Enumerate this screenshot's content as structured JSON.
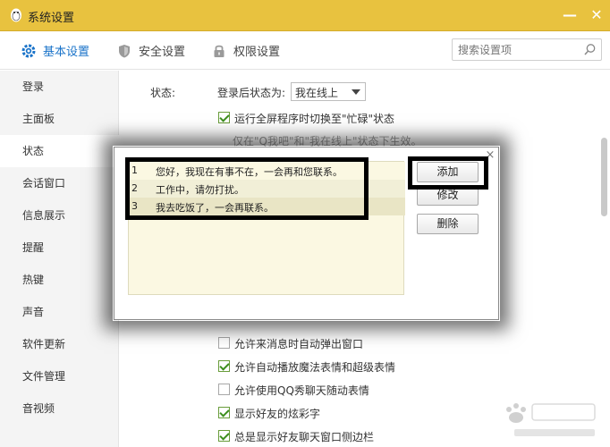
{
  "window": {
    "title": "系统设置",
    "minimize_glyph": "—",
    "close_glyph": "✕"
  },
  "tabs": [
    {
      "label": "基本设置",
      "icon": "gear-icon",
      "active": true
    },
    {
      "label": "安全设置",
      "icon": "shield-icon",
      "active": false
    },
    {
      "label": "权限设置",
      "icon": "lock-icon",
      "active": false
    }
  ],
  "search": {
    "placeholder": "搜索设置项",
    "icon": "search-icon"
  },
  "sidebar": {
    "items": [
      {
        "label": "登录"
      },
      {
        "label": "主面板"
      },
      {
        "label": "状态",
        "active": true
      },
      {
        "label": "会话窗口"
      },
      {
        "label": "信息展示"
      },
      {
        "label": "提醒"
      },
      {
        "label": "热键"
      },
      {
        "label": "声音"
      },
      {
        "label": "软件更新"
      },
      {
        "label": "文件管理"
      },
      {
        "label": "音视频"
      }
    ]
  },
  "status_section": {
    "section_label": "状态:",
    "login_status_label": "登录后状态为:",
    "login_status_value": "我在线上",
    "options": [
      {
        "label": "运行全屏程序时切换至\"忙碌\"状态",
        "checked": true
      },
      {
        "label": "允许来消息时自动弹出窗口",
        "checked": false
      },
      {
        "label": "允许自动播放魔法表情和超级表情",
        "checked": true
      },
      {
        "label": "允许使用QQ秀聊天随动表情",
        "checked": false
      },
      {
        "label": "显示好友的炫彩字",
        "checked": true
      },
      {
        "label": "总是显示好友聊天窗口侧边栏",
        "checked": true
      }
    ],
    "hint": "仅在\"Q我吧\"和\"我在线上\"状态下生效。"
  },
  "modal": {
    "close_glyph": "×",
    "messages": [
      {
        "num": "1",
        "text": "您好，我现在有事不在，一会再和您联系。"
      },
      {
        "num": "2",
        "text": "工作中，请勿打扰。"
      },
      {
        "num": "3",
        "text": "我去吃饭了，一会再联系。"
      }
    ],
    "buttons": {
      "add": "添加",
      "edit": "修改",
      "delete": "删除"
    }
  },
  "colors": {
    "titlebar": "#e8c23f",
    "accent": "#1a73c9",
    "check": "#3d8f1e"
  }
}
